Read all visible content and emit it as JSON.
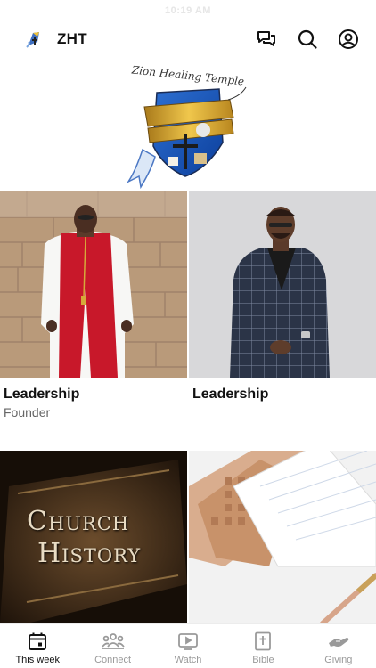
{
  "status": {
    "time": "10:19 AM"
  },
  "header": {
    "app_name": "ZHT"
  },
  "banner": {
    "crest_title": "Zion Healing Temple"
  },
  "cards": [
    {
      "title": "Leadership",
      "subtitle": "Founder"
    },
    {
      "title": "Leadership",
      "subtitle": ""
    },
    {
      "overlay_line1": "Church",
      "overlay_line2": "History"
    }
  ],
  "tabs": [
    {
      "label": "This week",
      "icon": "calendar-icon",
      "active": true
    },
    {
      "label": "Connect",
      "icon": "people-icon",
      "active": false
    },
    {
      "label": "Watch",
      "icon": "play-icon",
      "active": false
    },
    {
      "label": "Bible",
      "icon": "bible-icon",
      "active": false
    },
    {
      "label": "Giving",
      "icon": "giving-hand-icon",
      "active": false
    }
  ],
  "colors": {
    "accent": "#111111",
    "inactive": "#9a9a9a",
    "stole": "#c8182a",
    "robe": "#f7f7f5"
  }
}
